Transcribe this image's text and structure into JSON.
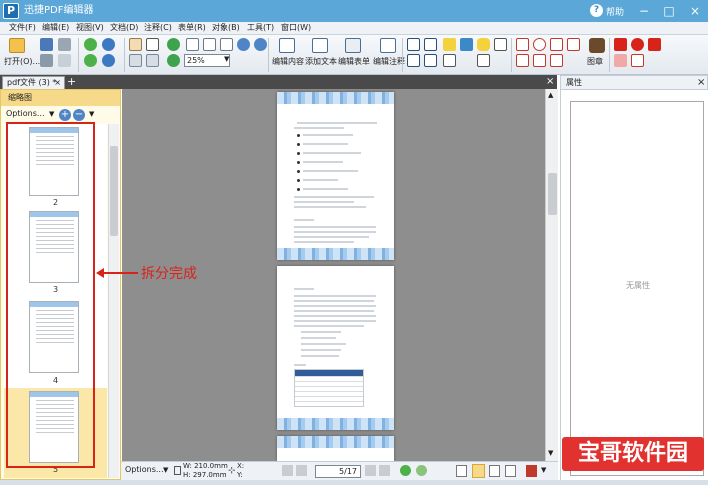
{
  "window": {
    "title": "迅捷PDF编辑器",
    "help": "帮助",
    "controls": [
      "−",
      "□",
      "×"
    ]
  },
  "menu": [
    "文件(F)",
    "编辑(E)",
    "视图(V)",
    "文档(D)",
    "注释(C)",
    "表单(R)",
    "对象(B)",
    "工具(T)",
    "窗口(W)"
  ],
  "toolbar": {
    "open_label": "打开(O)...",
    "zoom_value": "25%",
    "edit_content": "编辑内容",
    "add_text": "添加文本",
    "edit_form": "编辑表单",
    "edit_annotation": "编辑注释",
    "stamp": "图章"
  },
  "tabs": {
    "doc_tab": "pdf文件 (3) *",
    "close": "×",
    "add": "+",
    "pane_close": "×"
  },
  "thumbnails": {
    "header": "缩略图",
    "options": "Options...",
    "pages": [
      {
        "label": "2"
      },
      {
        "label": "3"
      },
      {
        "label": "4"
      },
      {
        "label": "5"
      }
    ]
  },
  "annotation": {
    "split_done": "拆分完成",
    "color": "#d8231a"
  },
  "status": {
    "options": "Options...",
    "width": "W: 210.0mm",
    "height": "H: 297.0mm",
    "x": "X:",
    "y": "Y:",
    "page_field": "5/17"
  },
  "properties": {
    "header": "属性",
    "no_properties": "无属性"
  },
  "watermark": "宝哥软件园",
  "colors": {
    "titlebar": "#5aa7d8",
    "accent": "#2f5e99",
    "thumb_header": "#f7d98a"
  }
}
